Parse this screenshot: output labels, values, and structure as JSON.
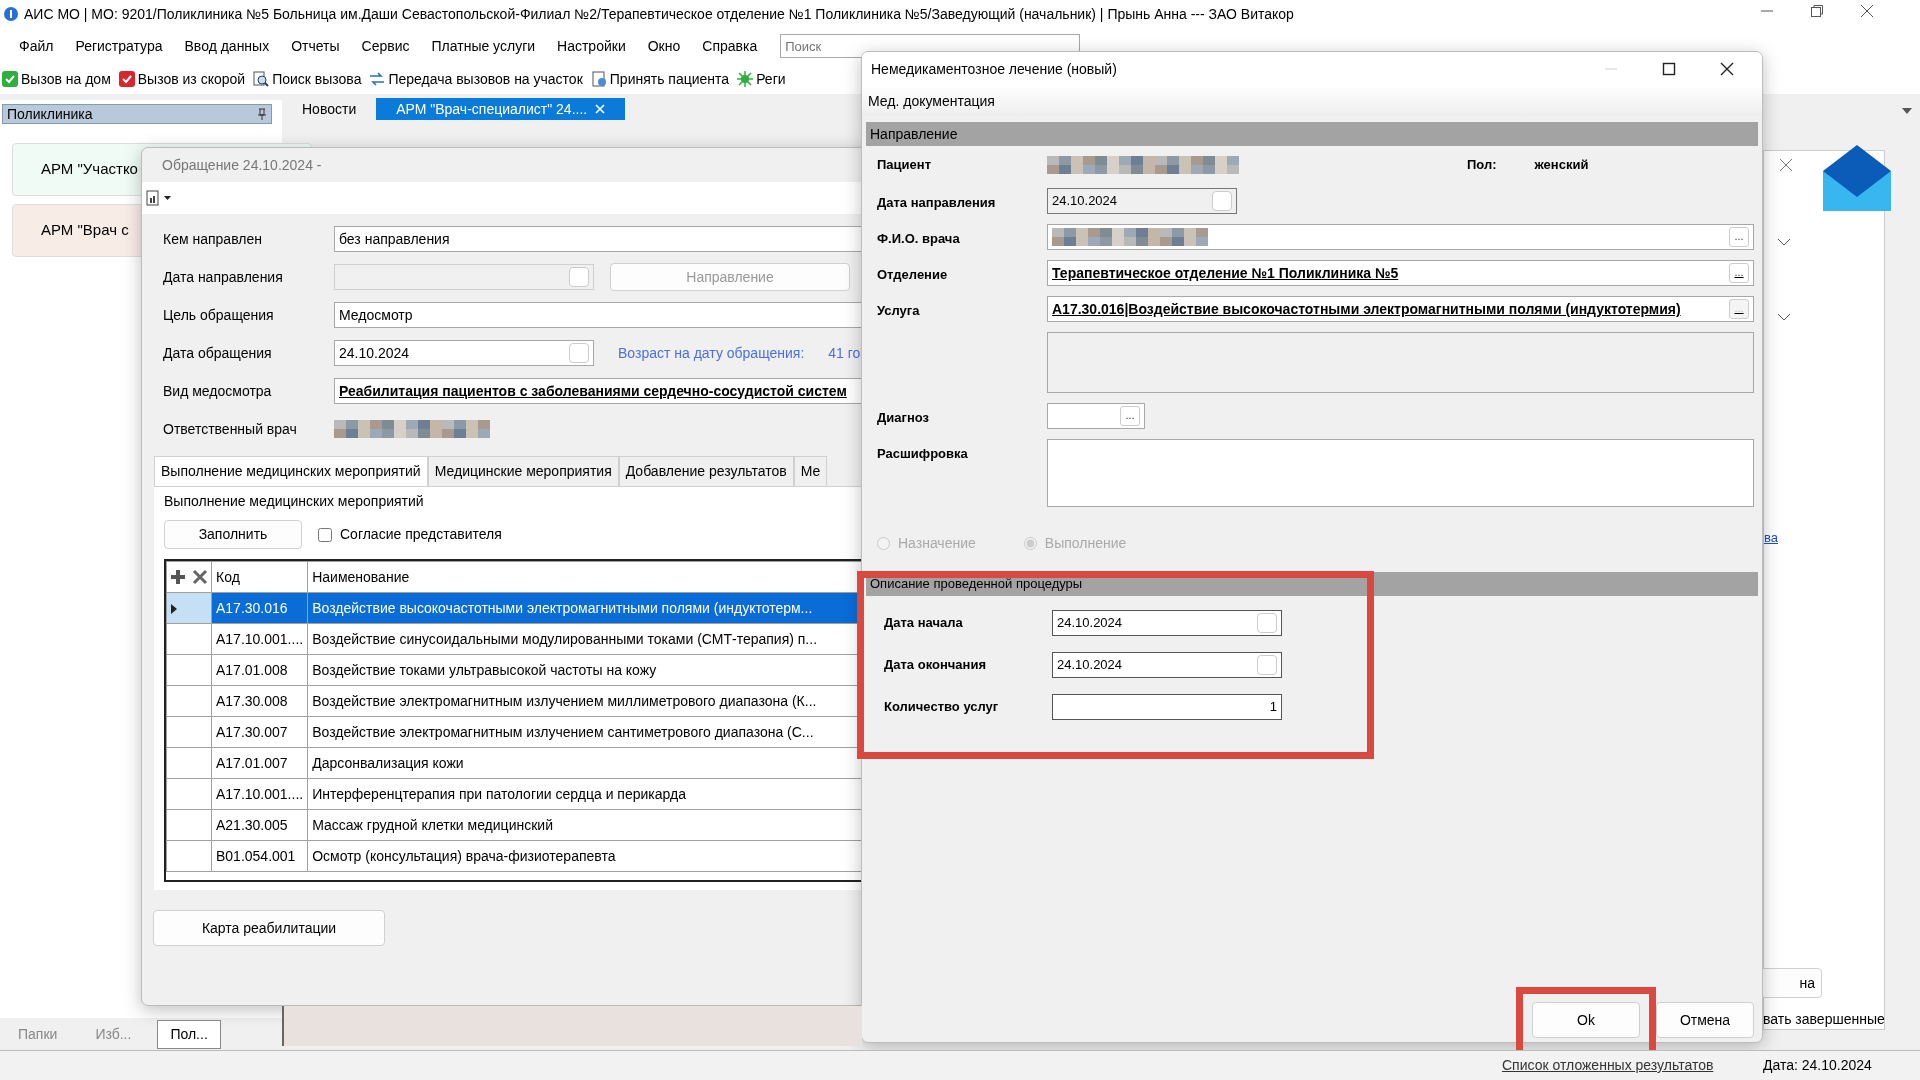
{
  "window": {
    "title": "АИС МО | МО: 9201/Поликлиника №5 Больница им.Даши Севастопольской-Филиал №2/Терапевтическое отделение №1 Поликлиника №5/Заведующий (начальник) | Прынь Анна --- ЗАО Витакор"
  },
  "menu": [
    "Файл",
    "Регистратура",
    "Ввод данных",
    "Отчеты",
    "Сервис",
    "Платные услуги",
    "Настройки",
    "Окно",
    "Справка"
  ],
  "search": {
    "placeholder": "Поиск"
  },
  "toolbar": [
    {
      "label": "Вызов на дом",
      "kind": "green-check"
    },
    {
      "label": "Вызов из скорой",
      "kind": "red-check"
    },
    {
      "label": "Поиск вызова",
      "kind": "search"
    },
    {
      "label": "Передача вызовов на участок",
      "kind": "transfer"
    },
    {
      "label": "Принять пациента",
      "kind": "accept"
    },
    {
      "label": "Реги",
      "kind": "sun"
    }
  ],
  "sidebar": {
    "title": "Поликлиника",
    "items": [
      {
        "label": "АРМ \"Участко",
        "color": "#f0fbf6"
      },
      {
        "label": "АРМ \"Врач с",
        "color": "#f8ece7"
      }
    ]
  },
  "tabs": [
    {
      "label": "Новости",
      "selected": false
    },
    {
      "label": "АРМ \"Врач-специалист\" 24....",
      "selected": true
    }
  ],
  "visit_dialog": {
    "title": "Обращение 24.10.2024 -",
    "fields": [
      {
        "label": "Кем направлен",
        "value": "без направления",
        "kind": "text"
      },
      {
        "label": "Дата направления",
        "kind": "date",
        "disabled": true,
        "checked": false
      },
      {
        "label": "Цель обращения",
        "value": "Медосмотр",
        "kind": "text"
      },
      {
        "label": "Дата обращения",
        "value": "24.10.2024",
        "kind": "date",
        "disabled": false,
        "checked": false
      },
      {
        "label": "Вид медосмотра",
        "value": "Реабилитация пациентов с заболеваниями сердечно-сосудистой систем",
        "kind": "link"
      },
      {
        "label": "Ответственный врач",
        "kind": "redacted"
      }
    ],
    "direction_button": {
      "label": "Направление",
      "disabled": true
    },
    "age_label": "Возраст на дату обращения:",
    "age_value": "41 го",
    "tabs": [
      {
        "label": "Выполнение медицинских мероприятий",
        "selected": true
      },
      {
        "label": "Медицинские мероприятия",
        "selected": false
      },
      {
        "label": "Добавление результатов",
        "selected": false
      },
      {
        "label": "Ме",
        "selected": false
      }
    ],
    "group_title": "Выполнение медицинских мероприятий",
    "fill_button": "Заполнить",
    "consent": {
      "label": "Согласие представителя",
      "checked": false
    },
    "grid": {
      "columns": [
        "Код",
        "Наименование"
      ],
      "rows": [
        {
          "code": "A17.30.016",
          "name": "Воздействие высокочастотными электромагнитными полями (индуктотерм...",
          "selected": true
        },
        {
          "code": "A17.10.001....",
          "name": "Воздействие синусоидальными модулированными токами (СМТ-терапия) п...",
          "selected": false
        },
        {
          "code": "A17.01.008",
          "name": "Воздействие токами ультравысокой частоты на кожу",
          "selected": false
        },
        {
          "code": "A17.30.008",
          "name": "Воздействие электромагнитным излучением миллиметрового диапазона (К...",
          "selected": false
        },
        {
          "code": "A17.30.007",
          "name": "Воздействие электромагнитным излучением сантиметрового диапазона (С...",
          "selected": false
        },
        {
          "code": "A17.01.007",
          "name": "Дарсонвализация кожи",
          "selected": false
        },
        {
          "code": "A17.10.001....",
          "name": "Интерференцтерапия при патологии сердца и перикарда",
          "selected": false
        },
        {
          "code": "A21.30.005",
          "name": "Массаж грудной клетки медицинский",
          "selected": false
        },
        {
          "code": "B01.054.001",
          "name": "Осмотр (консультация) врача-физиотерапевта",
          "selected": false
        }
      ]
    },
    "rehab_button": "Карта реабилитации"
  },
  "treatment_dialog": {
    "title": "Немедикаментозное лечение (новый)",
    "menu": "Мед. документация",
    "referral_section": "Направление",
    "patient_label": "Пациент",
    "gender_label": "Пол:",
    "gender_value": "женский",
    "fields": [
      {
        "label": "Дата направления",
        "value": "24.10.2024",
        "kind": "date",
        "disabled": true,
        "checked": false
      },
      {
        "label": "Ф.И.О. врача",
        "kind": "redacted",
        "button": "...",
        "disabled": false
      },
      {
        "label": "Отделение",
        "value": "Терапевтическое отделение №1 Поликлиника №5",
        "kind": "link",
        "button": "...",
        "disabled": false
      },
      {
        "label": "Услуга",
        "value": "A17.30.016|Воздействие высокочастотными электромагнитными полями (индуктотермия)",
        "kind": "link",
        "button": "...",
        "disabled": true
      },
      {
        "kind": "memo",
        "disabled": true
      },
      {
        "label": "Диагноз",
        "kind": "short",
        "button": "..."
      },
      {
        "label": "Расшифровка",
        "kind": "memo",
        "disabled": false
      }
    ],
    "radios": [
      {
        "label": "Назначение",
        "selected": false
      },
      {
        "label": "Выполнение",
        "selected": true
      }
    ],
    "procedure_section": "Описание проведенной процедуры",
    "procedure_fields": [
      {
        "label": "Дата начала",
        "value": "24.10.2024",
        "kind": "date",
        "checked": false
      },
      {
        "label": "Дата окончания",
        "value": "24.10.2024",
        "kind": "date",
        "checked": false
      },
      {
        "label": "Количество услуг",
        "value": "1",
        "kind": "number"
      }
    ],
    "ok_button": "Ok",
    "cancel_button": "Отмена"
  },
  "background_window": {
    "link": "ва",
    "button": "на",
    "checkbox_label": "вать завершенные"
  },
  "dock_tabs": [
    {
      "label": "Папки",
      "selected": false
    },
    {
      "label": "Изб...",
      "selected": false
    },
    {
      "label": "Пол...",
      "selected": true
    }
  ],
  "status_bar": {
    "link": "Список отложенных результатов",
    "date": "Дата: 24.10.2024"
  }
}
